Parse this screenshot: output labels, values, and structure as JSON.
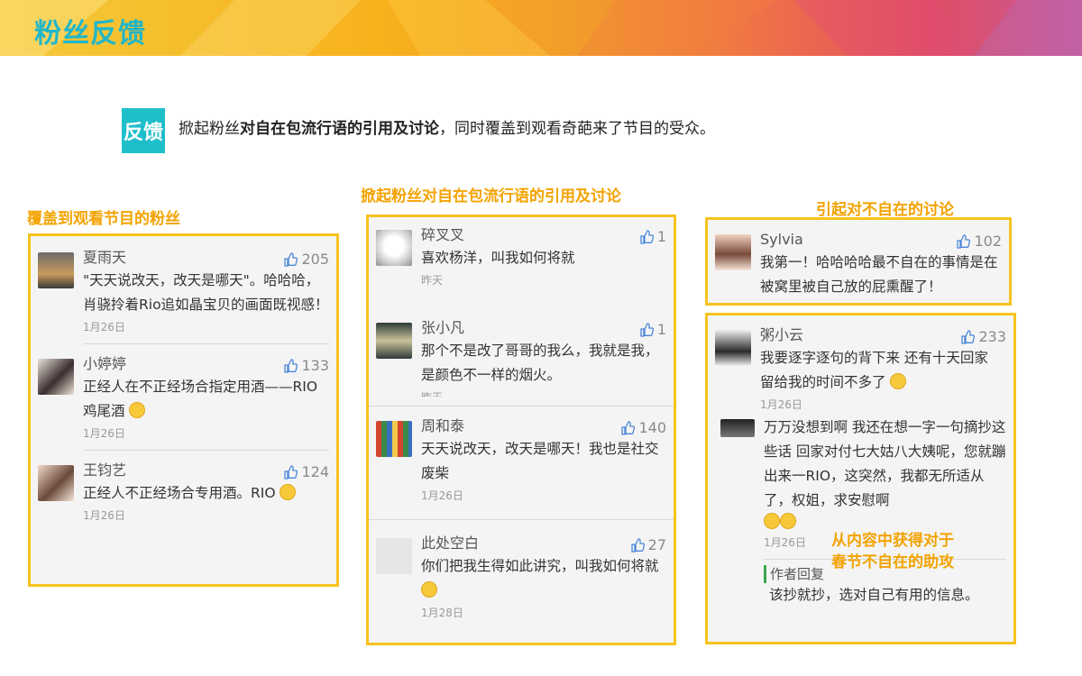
{
  "header": {
    "title": "粉丝反馈"
  },
  "intro": {
    "tag": "反馈",
    "text_pre": "掀起粉丝",
    "text_bold": "对自在包流行语的引用及讨论",
    "text_post": "，同时覆盖到观看奇葩来了节目的受众。"
  },
  "columns": [
    {
      "caption": "覆盖到观看节目的粉丝",
      "comments": [
        {
          "name": "夏雨天",
          "likes": "205",
          "text": "\"天天说改天，改天是哪天\"。哈哈哈，肖骁拎着Rio追如晶宝贝的画面既视感！",
          "date": "1月26日"
        },
        {
          "name": "小婷婷",
          "likes": "133",
          "text": "正经人在不正经场合指定用酒——RIO鸡尾酒",
          "date": "1月26日"
        },
        {
          "name": "王钧艺",
          "likes": "124",
          "text": "正经人不正经场合专用酒。RIO",
          "date": "1月26日"
        }
      ]
    },
    {
      "caption": "掀起粉丝对自在包流行语的引用及讨论",
      "comments": [
        {
          "name": "碎叉叉",
          "likes": "1",
          "text": "喜欢杨洋，叫我如何将就",
          "date": "昨天"
        },
        {
          "name": "张小凡",
          "likes": "1",
          "text": "那个不是改了哥哥的我么，我就是我，是颜色不一样的烟火。",
          "date": "昨天"
        },
        {
          "name": "周和泰",
          "likes": "140",
          "text": "天天说改天，改天是哪天！我也是社交废柴",
          "date": "1月26日"
        },
        {
          "name": "此处空白",
          "likes": "27",
          "text": "你们把我生得如此讲究，叫我如何将就",
          "date": "1月28日"
        }
      ]
    },
    {
      "caption": "引起对不自在的讨论",
      "comments": [
        {
          "name": "Sylvia",
          "likes": "102",
          "text": "我第一！哈哈哈哈最不自在的事情是在被窝里被自己放的屁熏醒了！"
        }
      ]
    },
    {
      "comments": [
        {
          "name": "粥小云",
          "likes": "233",
          "text": "我要逐字逐句的背下来 还有十天回家 留给我的时间不多了",
          "date": "1月26日"
        },
        {
          "text": "万万没想到啊 我还在想一字一句摘抄这些话 回家对付七大姑八大姨呢，您就蹦出来一RIO，这突然，我都无所适从了，权姐，求安慰啊",
          "date": "1月26日"
        }
      ],
      "note_line1": "从内容中获得对于",
      "note_line2": "春节不自在的助攻",
      "reply_label": "作者回复",
      "reply_text": "该抄就抄，选对自己有用的信息。"
    }
  ],
  "colors": {
    "accent": "#f7c31e",
    "caption": "#f3a300",
    "teal": "#1fbfca"
  }
}
